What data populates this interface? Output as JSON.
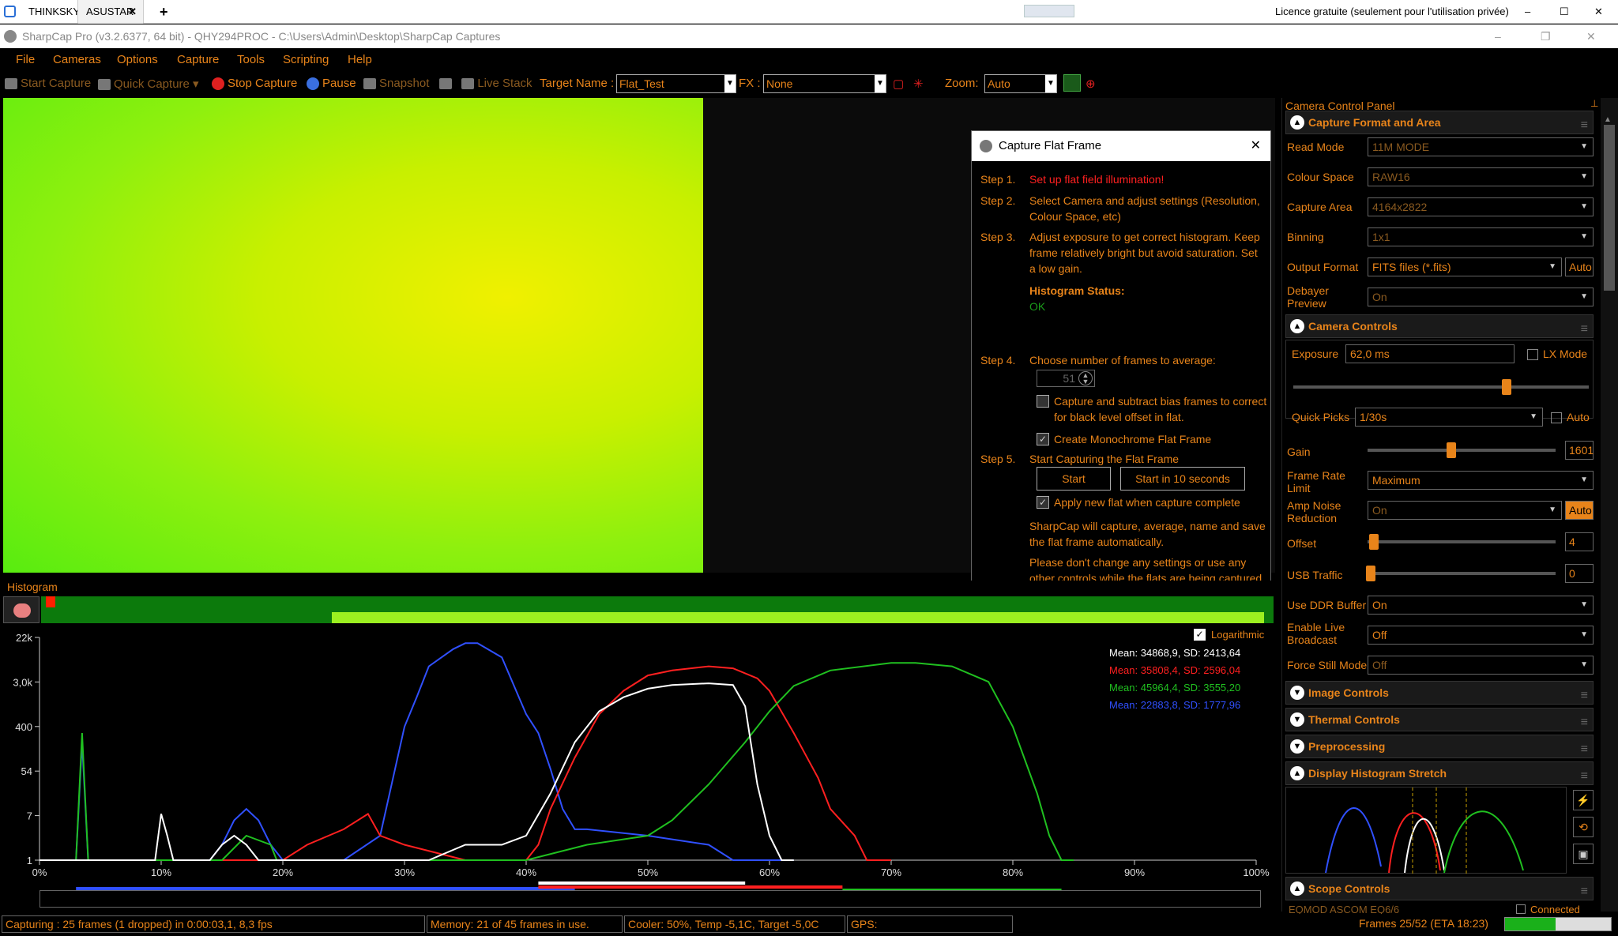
{
  "remote": {
    "tab1": "THINKSKY",
    "tab2": "ASUSTAR",
    "license": "Licence gratuite (seulement pour l'utilisation privée)"
  },
  "window": {
    "title": "SharpCap Pro (v3.2.6377, 64 bit) - QHY294PROC - C:\\Users\\Admin\\Desktop\\SharpCap Captures"
  },
  "menu": [
    "File",
    "Cameras",
    "Options",
    "Capture",
    "Tools",
    "Scripting",
    "Help"
  ],
  "toolbar": {
    "start_capture": "Start Capture",
    "quick_capture": "Quick Capture",
    "stop_capture": "Stop Capture",
    "pause": "Pause",
    "snapshot": "Snapshot",
    "live_stack": "Live Stack",
    "target_label": "Target Name :",
    "target_value": "Flat_Test",
    "fx_label": "FX :",
    "fx_value": "None",
    "zoom_label": "Zoom:",
    "zoom_value": "Auto"
  },
  "flat_dialog": {
    "title": "Capture Flat Frame",
    "step1_label": "Step 1.",
    "step1_text": "Set up flat field illumination!",
    "step2_label": "Step 2.",
    "step2_text": "Select Camera and adjust settings (Resolution, Colour Space, etc)",
    "step3_label": "Step 3.",
    "step3_text": "Adjust exposure to get correct histogram. Keep frame relatively bright but avoid saturation. Set a low gain.",
    "hist_status_label": "Histogram Status:",
    "hist_status_value": "OK",
    "step4_label": "Step 4.",
    "step4_text": "Choose number of frames to average:",
    "frames_value": "51",
    "bias_text": "Capture and subtract bias frames to correct for black level offset in flat.",
    "mono_text": "Create Monochrome Flat Frame",
    "step5_label": "Step 5.",
    "step5_text": "Start Capturing the Flat Frame",
    "start_btn": "Start",
    "start10_btn": "Start in 10 seconds",
    "apply_text": "Apply new flat when capture complete",
    "info1": "SharpCap will capture, average, name and save the flat frame automatically.",
    "info2": "Please don't change any settings or use any other controls while the flats are being captured."
  },
  "histogram": {
    "title": "Histogram",
    "logarithmic": "Logarithmic",
    "stats": [
      {
        "text": "Mean: 34868,9, SD: 2413,64",
        "color": "#ffffff"
      },
      {
        "text": "Mean: 35808,4, SD: 2596,04",
        "color": "#ff2020"
      },
      {
        "text": "Mean: 45964,4, SD: 3555,20",
        "color": "#20c020"
      },
      {
        "text": "Mean: 22883,8, SD: 1777,96",
        "color": "#3050ff"
      }
    ]
  },
  "chart_data": {
    "type": "line",
    "title": "Histogram",
    "xlabel": "",
    "ylabel": "",
    "x_ticks": [
      "0%",
      "10%",
      "20%",
      "30%",
      "40%",
      "50%",
      "60%",
      "70%",
      "80%",
      "90%",
      "100%"
    ],
    "y_ticks": [
      "1",
      "7",
      "54",
      "400",
      "3,0k",
      "22k"
    ],
    "y_scale": "log",
    "xlim": [
      0,
      100
    ],
    "ylim": [
      1,
      22000
    ],
    "grid": false,
    "series": [
      {
        "name": "",
        "color": "#3050ff",
        "x": [
          0,
          3,
          3.5,
          4,
          5,
          10,
          14,
          15,
          16,
          17,
          18,
          19,
          20,
          22,
          25,
          28,
          30,
          31,
          32,
          34,
          35,
          36,
          38,
          40,
          41,
          42,
          43,
          44,
          45,
          50,
          55,
          57,
          58,
          60,
          61,
          62
        ],
        "y": [
          1,
          1,
          200,
          1,
          1,
          1,
          1,
          2,
          6,
          10,
          6,
          2,
          1,
          1,
          1,
          3,
          400,
          1500,
          6000,
          13000,
          17000,
          17000,
          9000,
          700,
          300,
          60,
          10,
          4,
          4,
          3,
          2,
          1,
          1,
          1,
          1,
          1
        ]
      },
      {
        "name": "",
        "color": "#ff2020",
        "x": [
          0,
          20,
          22,
          25,
          27,
          28,
          30,
          35,
          40,
          41,
          42,
          44,
          46,
          48,
          50,
          52,
          55,
          57,
          59,
          60,
          62,
          64,
          65,
          67,
          68,
          69,
          70
        ],
        "y": [
          1,
          1,
          2,
          4,
          8,
          3,
          2,
          1,
          1,
          2,
          10,
          100,
          700,
          2000,
          4000,
          5000,
          6000,
          5500,
          3500,
          2000,
          300,
          40,
          10,
          3,
          1,
          1,
          1
        ]
      },
      {
        "name": "",
        "color": "#20c020",
        "x": [
          0,
          3,
          3.5,
          4,
          5,
          15,
          17,
          19,
          19.5,
          20,
          21,
          30,
          40,
          45,
          50,
          52,
          55,
          58,
          60,
          62,
          65,
          70,
          72,
          75,
          78,
          80,
          82,
          83,
          84,
          85
        ],
        "y": [
          1,
          1,
          300,
          1,
          1,
          1,
          3,
          2,
          1,
          1,
          1,
          1,
          1,
          2,
          3,
          6,
          30,
          200,
          800,
          2500,
          5000,
          7000,
          7000,
          6000,
          3000,
          400,
          20,
          3,
          1,
          1
        ]
      },
      {
        "name": "",
        "color": "#ffffff",
        "x": [
          0,
          9.5,
          10,
          10.5,
          11,
          14,
          15,
          16,
          17,
          18,
          32,
          35,
          38,
          40,
          42,
          44,
          46,
          48,
          50,
          52,
          55,
          57,
          58,
          59,
          60,
          61,
          62
        ],
        "y": [
          1,
          1,
          8,
          3,
          1,
          1,
          2,
          3,
          2,
          1,
          1,
          2,
          2,
          3,
          20,
          200,
          800,
          1500,
          2200,
          2600,
          2800,
          2600,
          1000,
          30,
          3,
          1,
          1
        ]
      }
    ]
  },
  "ccp": {
    "title": "Camera Control Panel",
    "sec_format": "Capture Format and Area",
    "read_mode_label": "Read Mode",
    "read_mode": "11M MODE",
    "colour_space_label": "Colour Space",
    "colour_space": "RAW16",
    "capture_area_label": "Capture Area",
    "capture_area": "4164x2822",
    "binning_label": "Binning",
    "binning": "1x1",
    "output_format_label": "Output Format",
    "output_format": "FITS files (*.fits)",
    "auto": "Auto",
    "debayer_label": "Debayer Preview",
    "debayer": "On",
    "sec_camera": "Camera Controls",
    "exposure_label": "Exposure",
    "exposure": "62,0 ms",
    "lx_mode": "LX Mode",
    "quick_picks_label": "Quick Picks",
    "quick_picks": "1/30s",
    "gain_label": "Gain",
    "gain": "1601",
    "frame_rate_label": "Frame Rate Limit",
    "frame_rate": "Maximum",
    "amp_noise_label": "Amp Noise Reduction",
    "amp_noise": "On",
    "offset_label": "Offset",
    "offset": "4",
    "usb_label": "USB Traffic",
    "usb": "0",
    "ddr_label": "Use DDR Buffer",
    "ddr": "On",
    "live_broadcast_label": "Enable Live Broadcast",
    "live_broadcast": "Off",
    "force_still_label": "Force Still Mode",
    "force_still": "Off",
    "sec_image": "Image Controls",
    "sec_thermal": "Thermal Controls",
    "sec_preproc": "Preprocessing",
    "sec_stretch": "Display Histogram Stretch",
    "sec_scope": "Scope Controls",
    "scope_device": "EQMOD ASCOM EQ6/6",
    "scope_connected": "Connected"
  },
  "status": {
    "capturing": "Capturing : 25 frames (1 dropped) in 0:00:03,1, 8,3 fps",
    "memory": "Memory: 21 of 45 frames in use.",
    "cooler": "Cooler: 50%, Temp -5,1C, Target -5,0C",
    "gps": "GPS:",
    "frames": "Frames 25/52 (ETA 18:23)",
    "progress": 0.48
  }
}
